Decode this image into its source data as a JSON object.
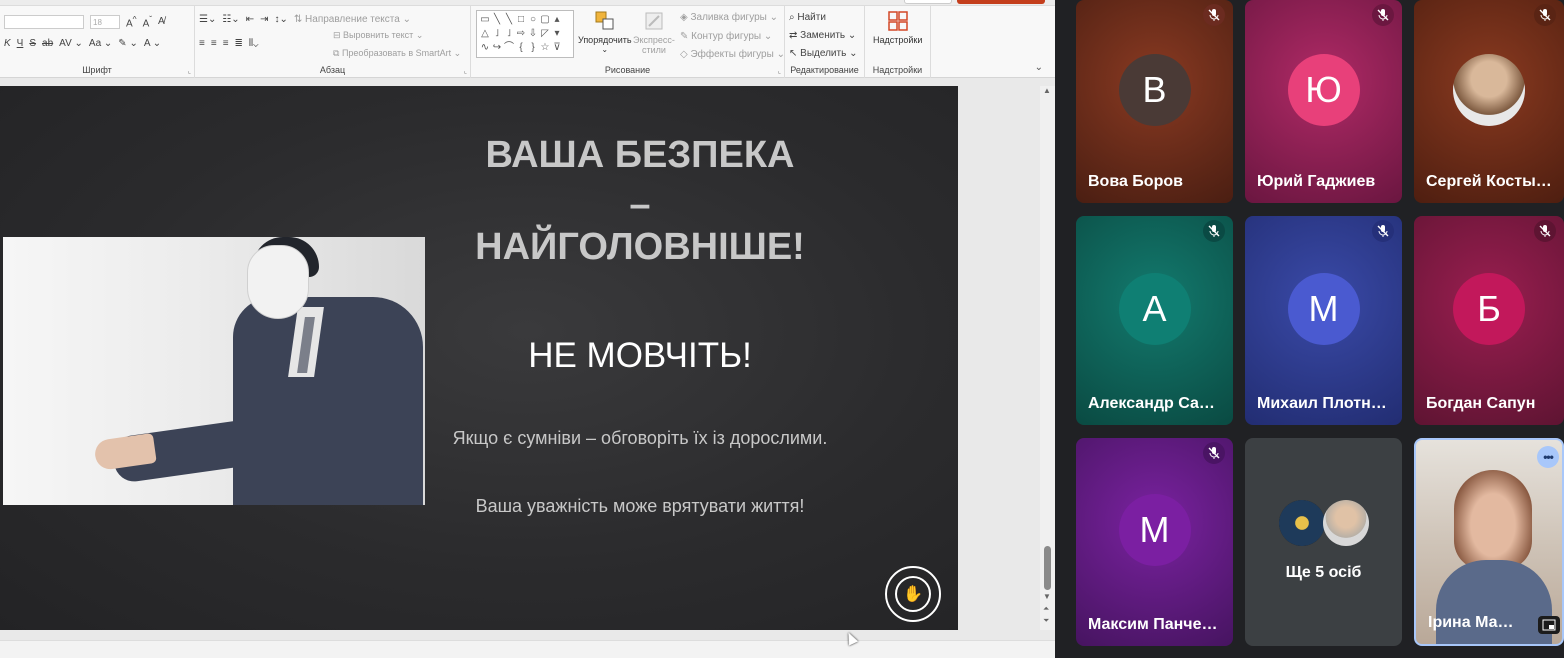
{
  "ribbon": {
    "font_size": "18",
    "groups": {
      "font": "Шрифт",
      "paragraph": "Абзац",
      "drawing": "Рисование",
      "editing": "Редактирование",
      "addins": "Надстройки"
    },
    "paragraph_items": {
      "text_direction": "Направление текста",
      "align_text": "Выровнить текст",
      "smartart": "Преобразовать в SmartArt"
    },
    "drawing_items": {
      "arrange": "Упорядочить",
      "quick_styles_1": "Экспресс-",
      "quick_styles_2": "стили",
      "shape_fill": "Заливка фигуры",
      "shape_outline": "Контур фигуры",
      "shape_effects": "Эффекты фигуры"
    },
    "editing_items": {
      "find": "Найти",
      "replace": "Заменить",
      "select": "Выделить"
    },
    "addins_button": "Надстройки"
  },
  "slide": {
    "title_line1": "ВАША БЕЗПЕКА",
    "title_dash": "–",
    "title_line2": "НАЙГОЛОВНІШЕ!",
    "subtitle": "НЕ МОВЧІТЬ!",
    "body1": "Якщо є сумніви – обговоріть їх із дорослими.",
    "body2": "Ваша уважність може врятувати життя!"
  },
  "participants": [
    {
      "name": "Вова Боров",
      "initial": "В",
      "bg": "#5a2a1a",
      "avatar_bg": "#4a3a36",
      "mic_bg": "#6b2b20"
    },
    {
      "name": "Юрий Гаджиев",
      "initial": "Ю",
      "bg": "#8a1d4f",
      "avatar_bg": "#e8407a",
      "mic_bg": "#6b1740"
    },
    {
      "name": "Сергей Косты…",
      "initial": "",
      "bg": "#6b2a16",
      "avatar_bg": "#8a7a6a",
      "mic_bg": "#5a2414"
    },
    {
      "name": "Александр Са…",
      "initial": "А",
      "bg": "#0c5a52",
      "avatar_bg": "#0f7f73",
      "mic_bg": "#0a4a44"
    },
    {
      "name": "Михаил Плотн…",
      "initial": "М",
      "bg": "#2c3a8a",
      "avatar_bg": "#4a5ad0",
      "mic_bg": "#25307a"
    },
    {
      "name": "Богдан Сапун",
      "initial": "Б",
      "bg": "#7a1a40",
      "avatar_bg": "#c2185b",
      "mic_bg": "#5e1432"
    },
    {
      "name": "Максим Панче…",
      "initial": "М",
      "bg": "#5a1a7a",
      "avatar_bg": "#7b1fa2",
      "mic_bg": "#4a1464"
    },
    {
      "name": "Ще 5 осіб",
      "initial": "",
      "bg": "#3c4043",
      "avatar_bg": "",
      "mic_bg": ""
    },
    {
      "name": "Ірина Ма…",
      "initial": "",
      "bg": "#c9b8a8",
      "avatar_bg": "",
      "mic_bg": ""
    }
  ]
}
